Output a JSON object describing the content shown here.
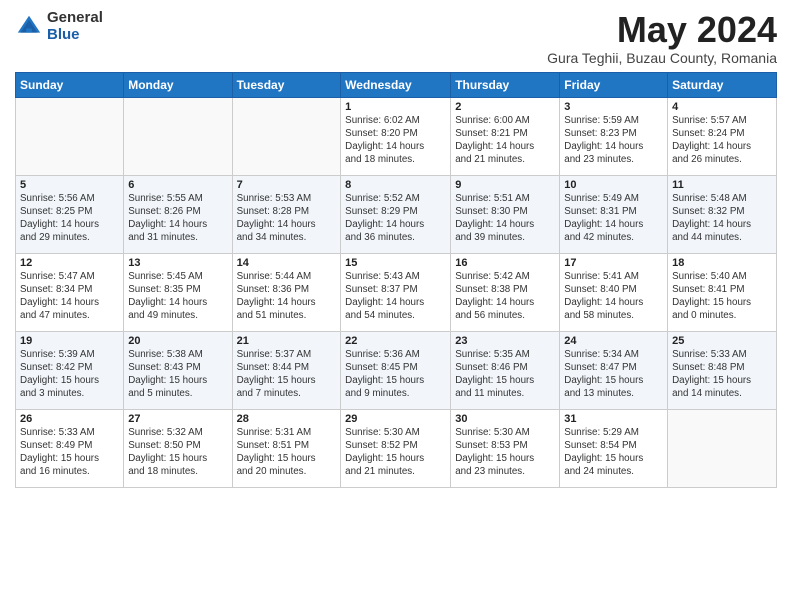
{
  "header": {
    "logo_general": "General",
    "logo_blue": "Blue",
    "month_title": "May 2024",
    "location": "Gura Teghii, Buzau County, Romania"
  },
  "weekdays": [
    "Sunday",
    "Monday",
    "Tuesday",
    "Wednesday",
    "Thursday",
    "Friday",
    "Saturday"
  ],
  "weeks": [
    [
      {
        "day": "",
        "info": ""
      },
      {
        "day": "",
        "info": ""
      },
      {
        "day": "",
        "info": ""
      },
      {
        "day": "1",
        "info": "Sunrise: 6:02 AM\nSunset: 8:20 PM\nDaylight: 14 hours\nand 18 minutes."
      },
      {
        "day": "2",
        "info": "Sunrise: 6:00 AM\nSunset: 8:21 PM\nDaylight: 14 hours\nand 21 minutes."
      },
      {
        "day": "3",
        "info": "Sunrise: 5:59 AM\nSunset: 8:23 PM\nDaylight: 14 hours\nand 23 minutes."
      },
      {
        "day": "4",
        "info": "Sunrise: 5:57 AM\nSunset: 8:24 PM\nDaylight: 14 hours\nand 26 minutes."
      }
    ],
    [
      {
        "day": "5",
        "info": "Sunrise: 5:56 AM\nSunset: 8:25 PM\nDaylight: 14 hours\nand 29 minutes."
      },
      {
        "day": "6",
        "info": "Sunrise: 5:55 AM\nSunset: 8:26 PM\nDaylight: 14 hours\nand 31 minutes."
      },
      {
        "day": "7",
        "info": "Sunrise: 5:53 AM\nSunset: 8:28 PM\nDaylight: 14 hours\nand 34 minutes."
      },
      {
        "day": "8",
        "info": "Sunrise: 5:52 AM\nSunset: 8:29 PM\nDaylight: 14 hours\nand 36 minutes."
      },
      {
        "day": "9",
        "info": "Sunrise: 5:51 AM\nSunset: 8:30 PM\nDaylight: 14 hours\nand 39 minutes."
      },
      {
        "day": "10",
        "info": "Sunrise: 5:49 AM\nSunset: 8:31 PM\nDaylight: 14 hours\nand 42 minutes."
      },
      {
        "day": "11",
        "info": "Sunrise: 5:48 AM\nSunset: 8:32 PM\nDaylight: 14 hours\nand 44 minutes."
      }
    ],
    [
      {
        "day": "12",
        "info": "Sunrise: 5:47 AM\nSunset: 8:34 PM\nDaylight: 14 hours\nand 47 minutes."
      },
      {
        "day": "13",
        "info": "Sunrise: 5:45 AM\nSunset: 8:35 PM\nDaylight: 14 hours\nand 49 minutes."
      },
      {
        "day": "14",
        "info": "Sunrise: 5:44 AM\nSunset: 8:36 PM\nDaylight: 14 hours\nand 51 minutes."
      },
      {
        "day": "15",
        "info": "Sunrise: 5:43 AM\nSunset: 8:37 PM\nDaylight: 14 hours\nand 54 minutes."
      },
      {
        "day": "16",
        "info": "Sunrise: 5:42 AM\nSunset: 8:38 PM\nDaylight: 14 hours\nand 56 minutes."
      },
      {
        "day": "17",
        "info": "Sunrise: 5:41 AM\nSunset: 8:40 PM\nDaylight: 14 hours\nand 58 minutes."
      },
      {
        "day": "18",
        "info": "Sunrise: 5:40 AM\nSunset: 8:41 PM\nDaylight: 15 hours\nand 0 minutes."
      }
    ],
    [
      {
        "day": "19",
        "info": "Sunrise: 5:39 AM\nSunset: 8:42 PM\nDaylight: 15 hours\nand 3 minutes."
      },
      {
        "day": "20",
        "info": "Sunrise: 5:38 AM\nSunset: 8:43 PM\nDaylight: 15 hours\nand 5 minutes."
      },
      {
        "day": "21",
        "info": "Sunrise: 5:37 AM\nSunset: 8:44 PM\nDaylight: 15 hours\nand 7 minutes."
      },
      {
        "day": "22",
        "info": "Sunrise: 5:36 AM\nSunset: 8:45 PM\nDaylight: 15 hours\nand 9 minutes."
      },
      {
        "day": "23",
        "info": "Sunrise: 5:35 AM\nSunset: 8:46 PM\nDaylight: 15 hours\nand 11 minutes."
      },
      {
        "day": "24",
        "info": "Sunrise: 5:34 AM\nSunset: 8:47 PM\nDaylight: 15 hours\nand 13 minutes."
      },
      {
        "day": "25",
        "info": "Sunrise: 5:33 AM\nSunset: 8:48 PM\nDaylight: 15 hours\nand 14 minutes."
      }
    ],
    [
      {
        "day": "26",
        "info": "Sunrise: 5:33 AM\nSunset: 8:49 PM\nDaylight: 15 hours\nand 16 minutes."
      },
      {
        "day": "27",
        "info": "Sunrise: 5:32 AM\nSunset: 8:50 PM\nDaylight: 15 hours\nand 18 minutes."
      },
      {
        "day": "28",
        "info": "Sunrise: 5:31 AM\nSunset: 8:51 PM\nDaylight: 15 hours\nand 20 minutes."
      },
      {
        "day": "29",
        "info": "Sunrise: 5:30 AM\nSunset: 8:52 PM\nDaylight: 15 hours\nand 21 minutes."
      },
      {
        "day": "30",
        "info": "Sunrise: 5:30 AM\nSunset: 8:53 PM\nDaylight: 15 hours\nand 23 minutes."
      },
      {
        "day": "31",
        "info": "Sunrise: 5:29 AM\nSunset: 8:54 PM\nDaylight: 15 hours\nand 24 minutes."
      },
      {
        "day": "",
        "info": ""
      }
    ]
  ]
}
